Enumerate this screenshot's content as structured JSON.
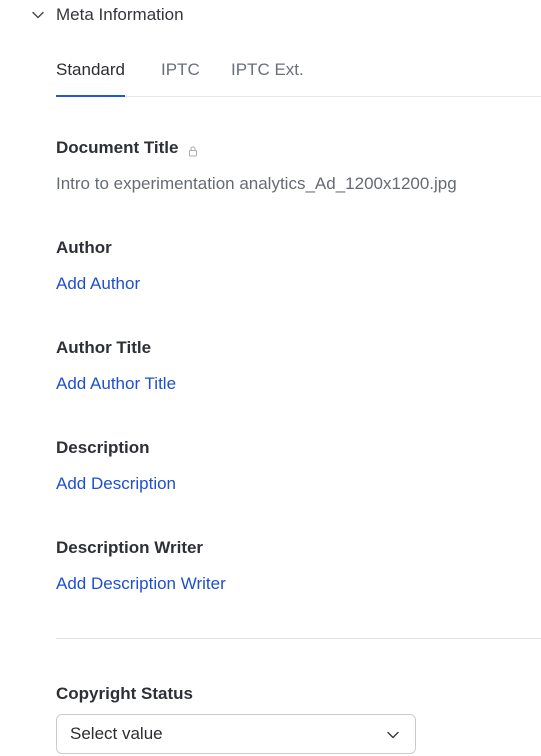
{
  "section": {
    "title": "Meta Information",
    "icon": "chevron-down-icon"
  },
  "tabs": [
    {
      "label": "Standard",
      "active": true
    },
    {
      "label": "IPTC",
      "active": false
    },
    {
      "label": "IPTC Ext.",
      "active": false
    }
  ],
  "fields": {
    "document_title": {
      "label": "Document Title",
      "value": "Intro to experimentation analytics_Ad_1200x1200.jpg",
      "icon": "lock-icon"
    },
    "author": {
      "label": "Author",
      "action": "Add Author"
    },
    "author_title": {
      "label": "Author Title",
      "action": "Add Author Title"
    },
    "description": {
      "label": "Description",
      "action": "Add Description"
    },
    "description_writer": {
      "label": "Description Writer",
      "action": "Add Description Writer"
    },
    "copyright_status": {
      "label": "Copyright Status",
      "placeholder": "Select value",
      "icon": "chevron-down-icon"
    }
  },
  "colors": {
    "accent": "#1f59d6",
    "link": "#1d4fcf",
    "muted_text": "#666b73"
  }
}
